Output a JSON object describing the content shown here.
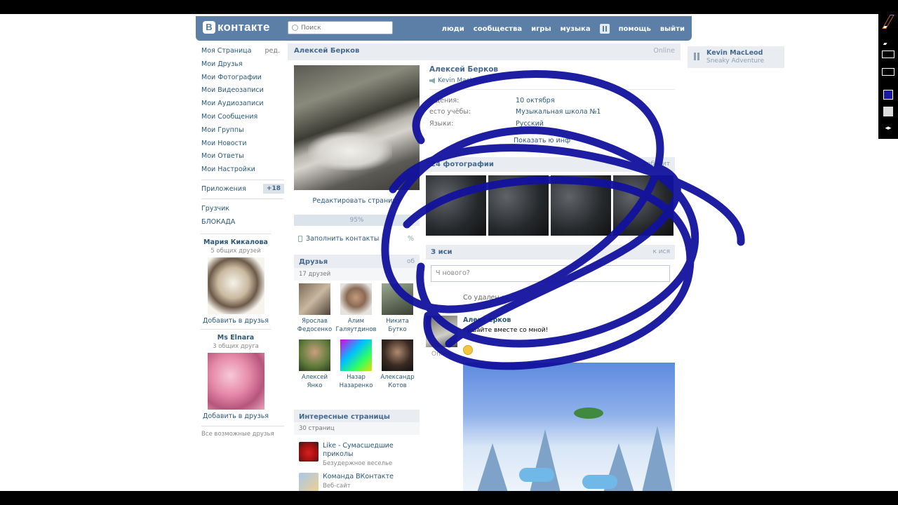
{
  "header": {
    "logo": "B",
    "logo_text": "контакте",
    "search_placeholder": "Поиск",
    "nav": [
      "люди",
      "сообщества",
      "игры",
      "музыка",
      "помощь",
      "выйти"
    ]
  },
  "leftnav": {
    "items": [
      "Моя Страница",
      "Мои Друзья",
      "Мои Фотографии",
      "Мои Видеозаписи",
      "Мои Аудиозаписи",
      "Мои Сообщения",
      "Мои Группы",
      "Мои Новости",
      "Мои Ответы",
      "Мои Настройки"
    ],
    "edit": "ред.",
    "apps_label": "Приложения",
    "apps_badge": "+18",
    "extra": [
      "Грузчик",
      "БЛОКАДА"
    ]
  },
  "suggestions": [
    {
      "name": "Мария Кикалова",
      "mutual": "5 общих друзей",
      "add": "Добавить в друзья"
    },
    {
      "name": "Ms Elnara",
      "mutual": "3 общих друга",
      "add": "Добавить в друзья"
    }
  ],
  "all_friends": "Все возможные друзья",
  "profile": {
    "name": "Алексей Берков",
    "online": "Online",
    "status": "Kevin MacLeod",
    "edit_page": "Редактировать страницу",
    "progress": "95%",
    "progress_value": 0.95,
    "fill_contacts": "Заполнить контакты",
    "fill_pct": "%",
    "info": [
      {
        "label": "ждения:",
        "value": "10 октября"
      },
      {
        "label": "есто учёбы:",
        "value": "Музыкальная школа №1"
      },
      {
        "label": "Языки:",
        "value": "Русский"
      }
    ],
    "show_more": "Показать          ю инф"
  },
  "friends_block": {
    "title": "Друзья",
    "link": "об",
    "count": "17 друзей",
    "items": [
      {
        "first": "Ярослав",
        "last": "Федосенко"
      },
      {
        "first": "Алим",
        "last": "Галяутдинов"
      },
      {
        "first": "Никита",
        "last": "Бутко"
      },
      {
        "first": "Алексей",
        "last": "Янко"
      },
      {
        "first": "Назар",
        "last": "Назаренко"
      },
      {
        "first": "Александр",
        "last": "Котов"
      }
    ]
  },
  "interests": {
    "title": "Интересные страницы",
    "count": "30 страниц",
    "items": [
      {
        "title": "Like - Сумасшедшие приколы",
        "sub": "Безудержное веселье"
      },
      {
        "title": "Команда ВКонтакте",
        "sub": "Веб-сайт"
      }
    ]
  },
  "photos": {
    "title": "24 фотографии",
    "link": "добавит"
  },
  "wall": {
    "title": "З         иси",
    "link": "к          ися",
    "placeholder": "Ч         нового?",
    "deleted": "Со          удален                 сь",
    "post_author": "Алекс     ерков",
    "post_text": "кушайте вместе со мной!",
    "post_online": "Online"
  },
  "audio": {
    "artist": "Kevin MacLeod",
    "title": "Sneaky Adventure"
  },
  "colors": {
    "header": "#5b7fa6",
    "link": "#2b587a",
    "scribble": "#12129e"
  }
}
